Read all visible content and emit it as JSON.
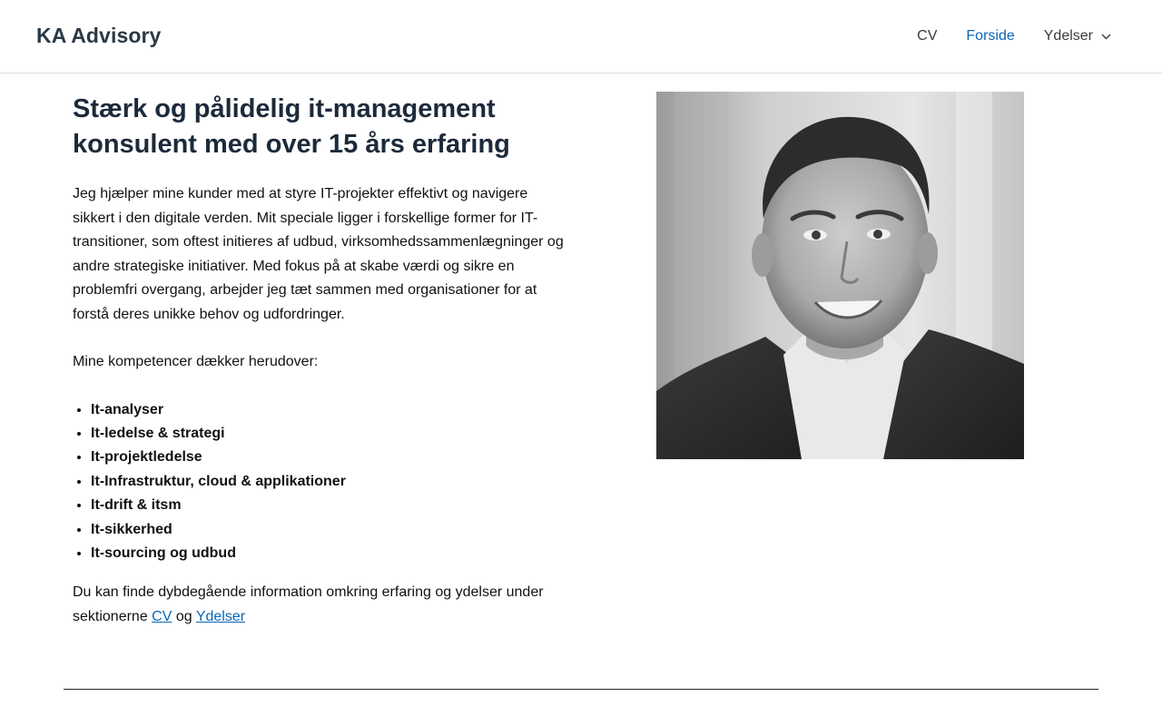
{
  "header": {
    "brand": "KA Advisory",
    "nav": [
      {
        "label": "CV"
      },
      {
        "label": "Forside"
      },
      {
        "label": "Ydelser"
      }
    ],
    "active_color": "#0a66b8"
  },
  "main": {
    "headline": "Stærk og pålidelig it-management konsulent med over 15 års erfaring",
    "intro": "Jeg hjælper mine kunder med at styre IT-projekter effektivt og navigere sikkert i den digitale verden. Mit speciale ligger i forskellige former for IT-transitioner, som oftest initieres af udbud, virksomhedssammenlægninger og andre strategiske initiativer. Med fokus på at skabe værdi og sikre en problemfri overgang, arbejder jeg tæt sammen med organisationer for at forstå deres unikke behov og udfordringer.",
    "competence_lead": "Mine kompetencer dækker herudover:",
    "competences": [
      "It-analyser",
      "It-ledelse & strategi",
      "It-projektledelse",
      "It-Infrastruktur, cloud & applikationer",
      "It-drift & itsm",
      "It-sikkerhed",
      "It-sourcing og udbud"
    ],
    "outro_prefix": "Du kan finde dybdegående information omkring erfaring og ydelser under sektionerne ",
    "outro_link_cv": "CV",
    "outro_join": " og ",
    "outro_link_services": "Ydelser"
  },
  "portrait": {
    "icon": "portrait-photo"
  }
}
